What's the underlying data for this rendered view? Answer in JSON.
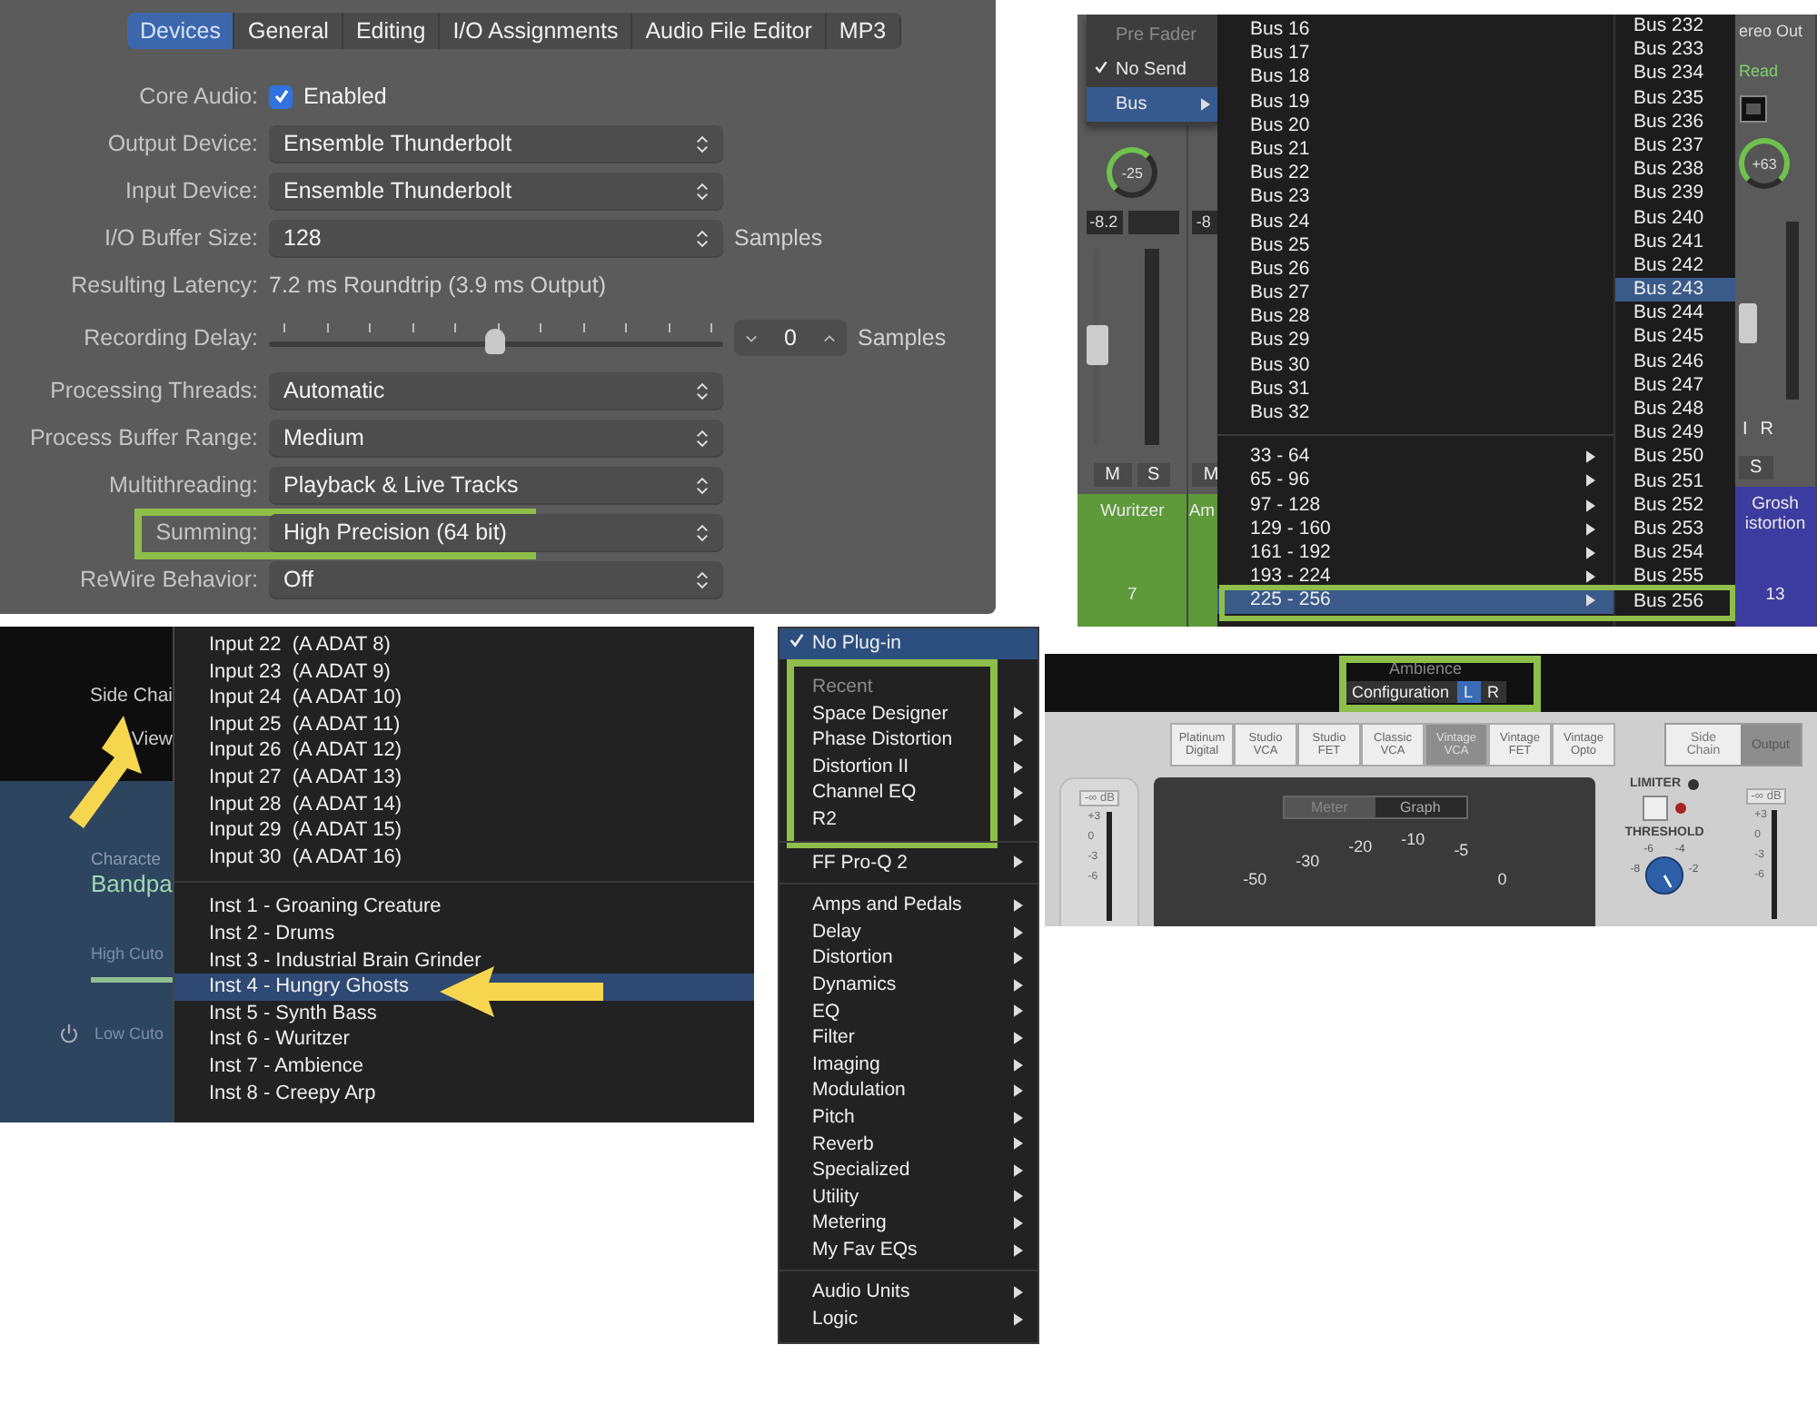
{
  "preferences": {
    "tabs": [
      {
        "label": "Devices",
        "selected": true
      },
      {
        "label": "General",
        "selected": false
      },
      {
        "label": "Editing",
        "selected": false
      },
      {
        "label": "I/O Assignments",
        "selected": false
      },
      {
        "label": "Audio File Editor",
        "selected": false
      },
      {
        "label": "MP3",
        "selected": false
      }
    ],
    "rows": [
      {
        "label": "Core Audio:",
        "kind": "checkbox",
        "value": "Enabled",
        "checked": true,
        "highlighted": false
      },
      {
        "label": "Output Device:",
        "kind": "select",
        "value": "Ensemble Thunderbolt",
        "highlighted": false
      },
      {
        "label": "Input Device:",
        "kind": "select",
        "value": "Ensemble Thunderbolt",
        "highlighted": false
      },
      {
        "label": "I/O Buffer Size:",
        "kind": "select",
        "value": "128",
        "suffix": "Samples",
        "highlighted": false
      },
      {
        "label": "Resulting Latency:",
        "kind": "text",
        "value": "7.2 ms Roundtrip (3.9 ms Output)",
        "highlighted": false
      },
      {
        "label": "Recording Delay:",
        "kind": "slider",
        "level": 0.5,
        "value": "0",
        "suffix": "Samples",
        "highlighted": false
      },
      {
        "label": "Processing Threads:",
        "kind": "select",
        "value": "Automatic",
        "highlighted": false
      },
      {
        "label": "Process Buffer Range:",
        "kind": "select",
        "value": "Medium",
        "highlighted": false
      },
      {
        "label": "Multithreading:",
        "kind": "select",
        "value": "Playback & Live Tracks",
        "highlighted": false
      },
      {
        "label": "Summing:",
        "kind": "select",
        "value": "High Precision (64 bit)",
        "highlighted": true
      },
      {
        "label": "ReWire Behavior:",
        "kind": "select",
        "value": "Off",
        "highlighted": false
      }
    ]
  },
  "mixer": {
    "send_menu": [
      {
        "label": "Pre Fader",
        "disabled": true,
        "checked": false,
        "selected": false,
        "submenu": false
      },
      {
        "label": "No Send",
        "disabled": false,
        "checked": true,
        "selected": false,
        "submenu": false
      },
      {
        "label": "Bus",
        "disabled": false,
        "checked": false,
        "selected": true,
        "submenu": true
      }
    ],
    "strips": [
      {
        "pan": "-25",
        "level": "-8.2",
        "mute": "M",
        "solo": "S",
        "name": "Wuritzer",
        "number": "7",
        "color": "#5e9a3a"
      },
      {
        "level": "-8",
        "mute": "M",
        "name": "Am",
        "color": "#5e9a3a"
      }
    ],
    "buses": [
      "Bus 16",
      "Bus 17",
      "Bus 18",
      "Bus 19",
      "Bus 20",
      "Bus 21",
      "Bus 22",
      "Bus 23",
      "Bus 24",
      "Bus 25",
      "Bus 26",
      "Bus 27",
      "Bus 28",
      "Bus 29",
      "Bus 30",
      "Bus 31",
      "Bus 32"
    ],
    "ranges": [
      {
        "label": "33 - 64",
        "selected": false
      },
      {
        "label": "65 - 96",
        "selected": false
      },
      {
        "label": "97 - 128",
        "selected": false
      },
      {
        "label": "129 - 160",
        "selected": false
      },
      {
        "label": "161 - 192",
        "selected": false
      },
      {
        "label": "193 - 224",
        "selected": false
      },
      {
        "label": "225 - 256",
        "selected": true
      }
    ],
    "sub_buses": [
      {
        "label": "Bus 232",
        "selected": false
      },
      {
        "label": "Bus 233",
        "selected": false
      },
      {
        "label": "Bus 234",
        "selected": false
      },
      {
        "label": "Bus 235",
        "selected": false
      },
      {
        "label": "Bus 236",
        "selected": false
      },
      {
        "label": "Bus 237",
        "selected": false
      },
      {
        "label": "Bus 238",
        "selected": false
      },
      {
        "label": "Bus 239",
        "selected": false
      },
      {
        "label": "Bus 240",
        "selected": false
      },
      {
        "label": "Bus 241",
        "selected": false
      },
      {
        "label": "Bus 242",
        "selected": false
      },
      {
        "label": "Bus 243",
        "selected": true
      },
      {
        "label": "Bus 244",
        "selected": false
      },
      {
        "label": "Bus 245",
        "selected": false
      },
      {
        "label": "Bus 246",
        "selected": false
      },
      {
        "label": "Bus 247",
        "selected": false
      },
      {
        "label": "Bus 248",
        "selected": false
      },
      {
        "label": "Bus 249",
        "selected": false
      },
      {
        "label": "Bus 250",
        "selected": false
      },
      {
        "label": "Bus 251",
        "selected": false
      },
      {
        "label": "Bus 252",
        "selected": false
      },
      {
        "label": "Bus 253",
        "selected": false
      },
      {
        "label": "Bus 254",
        "selected": false
      },
      {
        "label": "Bus 255",
        "selected": false
      },
      {
        "label": "Bus 256",
        "selected": false
      }
    ],
    "output_strip": {
      "output": "ereo Out",
      "automation": "Read",
      "pan": "+63",
      "input": "I",
      "record": "R",
      "solo": "S",
      "name_lines": [
        "Grosh",
        "istortion"
      ],
      "number": "13",
      "color": "#3c3ca0"
    }
  },
  "side_chain": {
    "plugin": {
      "side_chain": "Side Chai",
      "view": "View",
      "character_label": "Characte",
      "character_value": "Bandpa",
      "high_cut": "High Cuto",
      "high_cut_slider": {
        "level": 1
      },
      "low_cut": "Low Cuto"
    },
    "inputs": [
      "Input 22  (A ADAT 8)",
      "Input 23  (A ADAT 9)",
      "Input 24  (A ADAT 10)",
      "Input 25  (A ADAT 11)",
      "Input 26  (A ADAT 12)",
      "Input 27  (A ADAT 13)",
      "Input 28  (A ADAT 14)",
      "Input 29  (A ADAT 15)",
      "Input 30  (A ADAT 16)"
    ],
    "instruments": [
      {
        "label": "Inst 1 - Groaning Creature",
        "selected": false
      },
      {
        "label": "Inst 2 - Drums",
        "selected": false
      },
      {
        "label": "Inst 3 - Industrial Brain Grinder",
        "selected": false
      },
      {
        "label": "Inst 4 - Hungry Ghosts",
        "selected": true
      },
      {
        "label": "Inst 5 - Synth Bass",
        "selected": false
      },
      {
        "label": "Inst 6 - Wuritzer",
        "selected": false
      },
      {
        "label": "Inst 7 - Ambience",
        "selected": false
      },
      {
        "label": "Inst 8 - Creepy Arp",
        "selected": false
      }
    ]
  },
  "plugin_menu": {
    "top": {
      "label": "No Plug-in",
      "checked": true,
      "selected": true
    },
    "groups": [
      {
        "highlighted": true,
        "items": [
          {
            "label": "Recent",
            "kind": "header"
          },
          {
            "label": "Space Designer",
            "kind": "submenu"
          },
          {
            "label": "Phase Distortion",
            "kind": "submenu"
          },
          {
            "label": "Distortion II",
            "kind": "submenu"
          },
          {
            "label": "Channel EQ",
            "kind": "submenu"
          },
          {
            "label": "R2",
            "kind": "submenu"
          }
        ]
      },
      {
        "highlighted": false,
        "items": [
          {
            "label": "FF Pro-Q 2",
            "kind": "submenu"
          }
        ]
      },
      {
        "highlighted": false,
        "items": [
          {
            "label": "Amps and Pedals",
            "kind": "submenu"
          },
          {
            "label": "Delay",
            "kind": "submenu"
          },
          {
            "label": "Distortion",
            "kind": "submenu"
          },
          {
            "label": "Dynamics",
            "kind": "submenu"
          },
          {
            "label": "EQ",
            "kind": "submenu"
          },
          {
            "label": "Filter",
            "kind": "submenu"
          },
          {
            "label": "Imaging",
            "kind": "submenu"
          },
          {
            "label": "Modulation",
            "kind": "submenu"
          },
          {
            "label": "Pitch",
            "kind": "submenu"
          },
          {
            "label": "Reverb",
            "kind": "submenu"
          },
          {
            "label": "Specialized",
            "kind": "submenu"
          },
          {
            "label": "Utility",
            "kind": "submenu"
          },
          {
            "label": "Metering",
            "kind": "submenu"
          },
          {
            "label": "My Fav EQs",
            "kind": "submenu"
          }
        ]
      },
      {
        "highlighted": false,
        "items": [
          {
            "label": "Audio Units",
            "kind": "submenu"
          },
          {
            "label": "Logic",
            "kind": "submenu"
          }
        ]
      }
    ]
  },
  "compressor": {
    "title": "Ambience",
    "config": "Configuration",
    "channels": [
      {
        "label": "L",
        "selected": true
      },
      {
        "label": "R",
        "selected": false
      }
    ],
    "models": [
      {
        "label": "Platinum Digital",
        "selected": false
      },
      {
        "label": "Studio VCA",
        "selected": false
      },
      {
        "label": "Studio FET",
        "selected": false
      },
      {
        "label": "Classic VCA",
        "selected": false
      },
      {
        "label": "Vintage VCA",
        "selected": true
      },
      {
        "label": "Vintage FET",
        "selected": false
      },
      {
        "label": "Vintage Opto",
        "selected": false
      }
    ],
    "routing": [
      {
        "label": "Side Chain",
        "selected": false
      },
      {
        "label": "Output",
        "selected": true
      }
    ],
    "input_readout": "-∞ dB",
    "input_ticks": [
      "+3",
      "0",
      "-3",
      "-6"
    ],
    "views": [
      {
        "label": "Meter",
        "selected": true
      },
      {
        "label": "Graph",
        "selected": false
      }
    ],
    "scale": [
      "-50",
      "-30",
      "-20",
      "-10",
      "-5",
      "0"
    ],
    "limiter": "LIMITER",
    "threshold": "THRESHOLD",
    "threshold_ticks": [
      "-6",
      "-4",
      "-8",
      "-2"
    ],
    "output_readout": "-∞ dB",
    "output_ticks": [
      "+3",
      "0",
      "-3",
      "-6"
    ]
  }
}
